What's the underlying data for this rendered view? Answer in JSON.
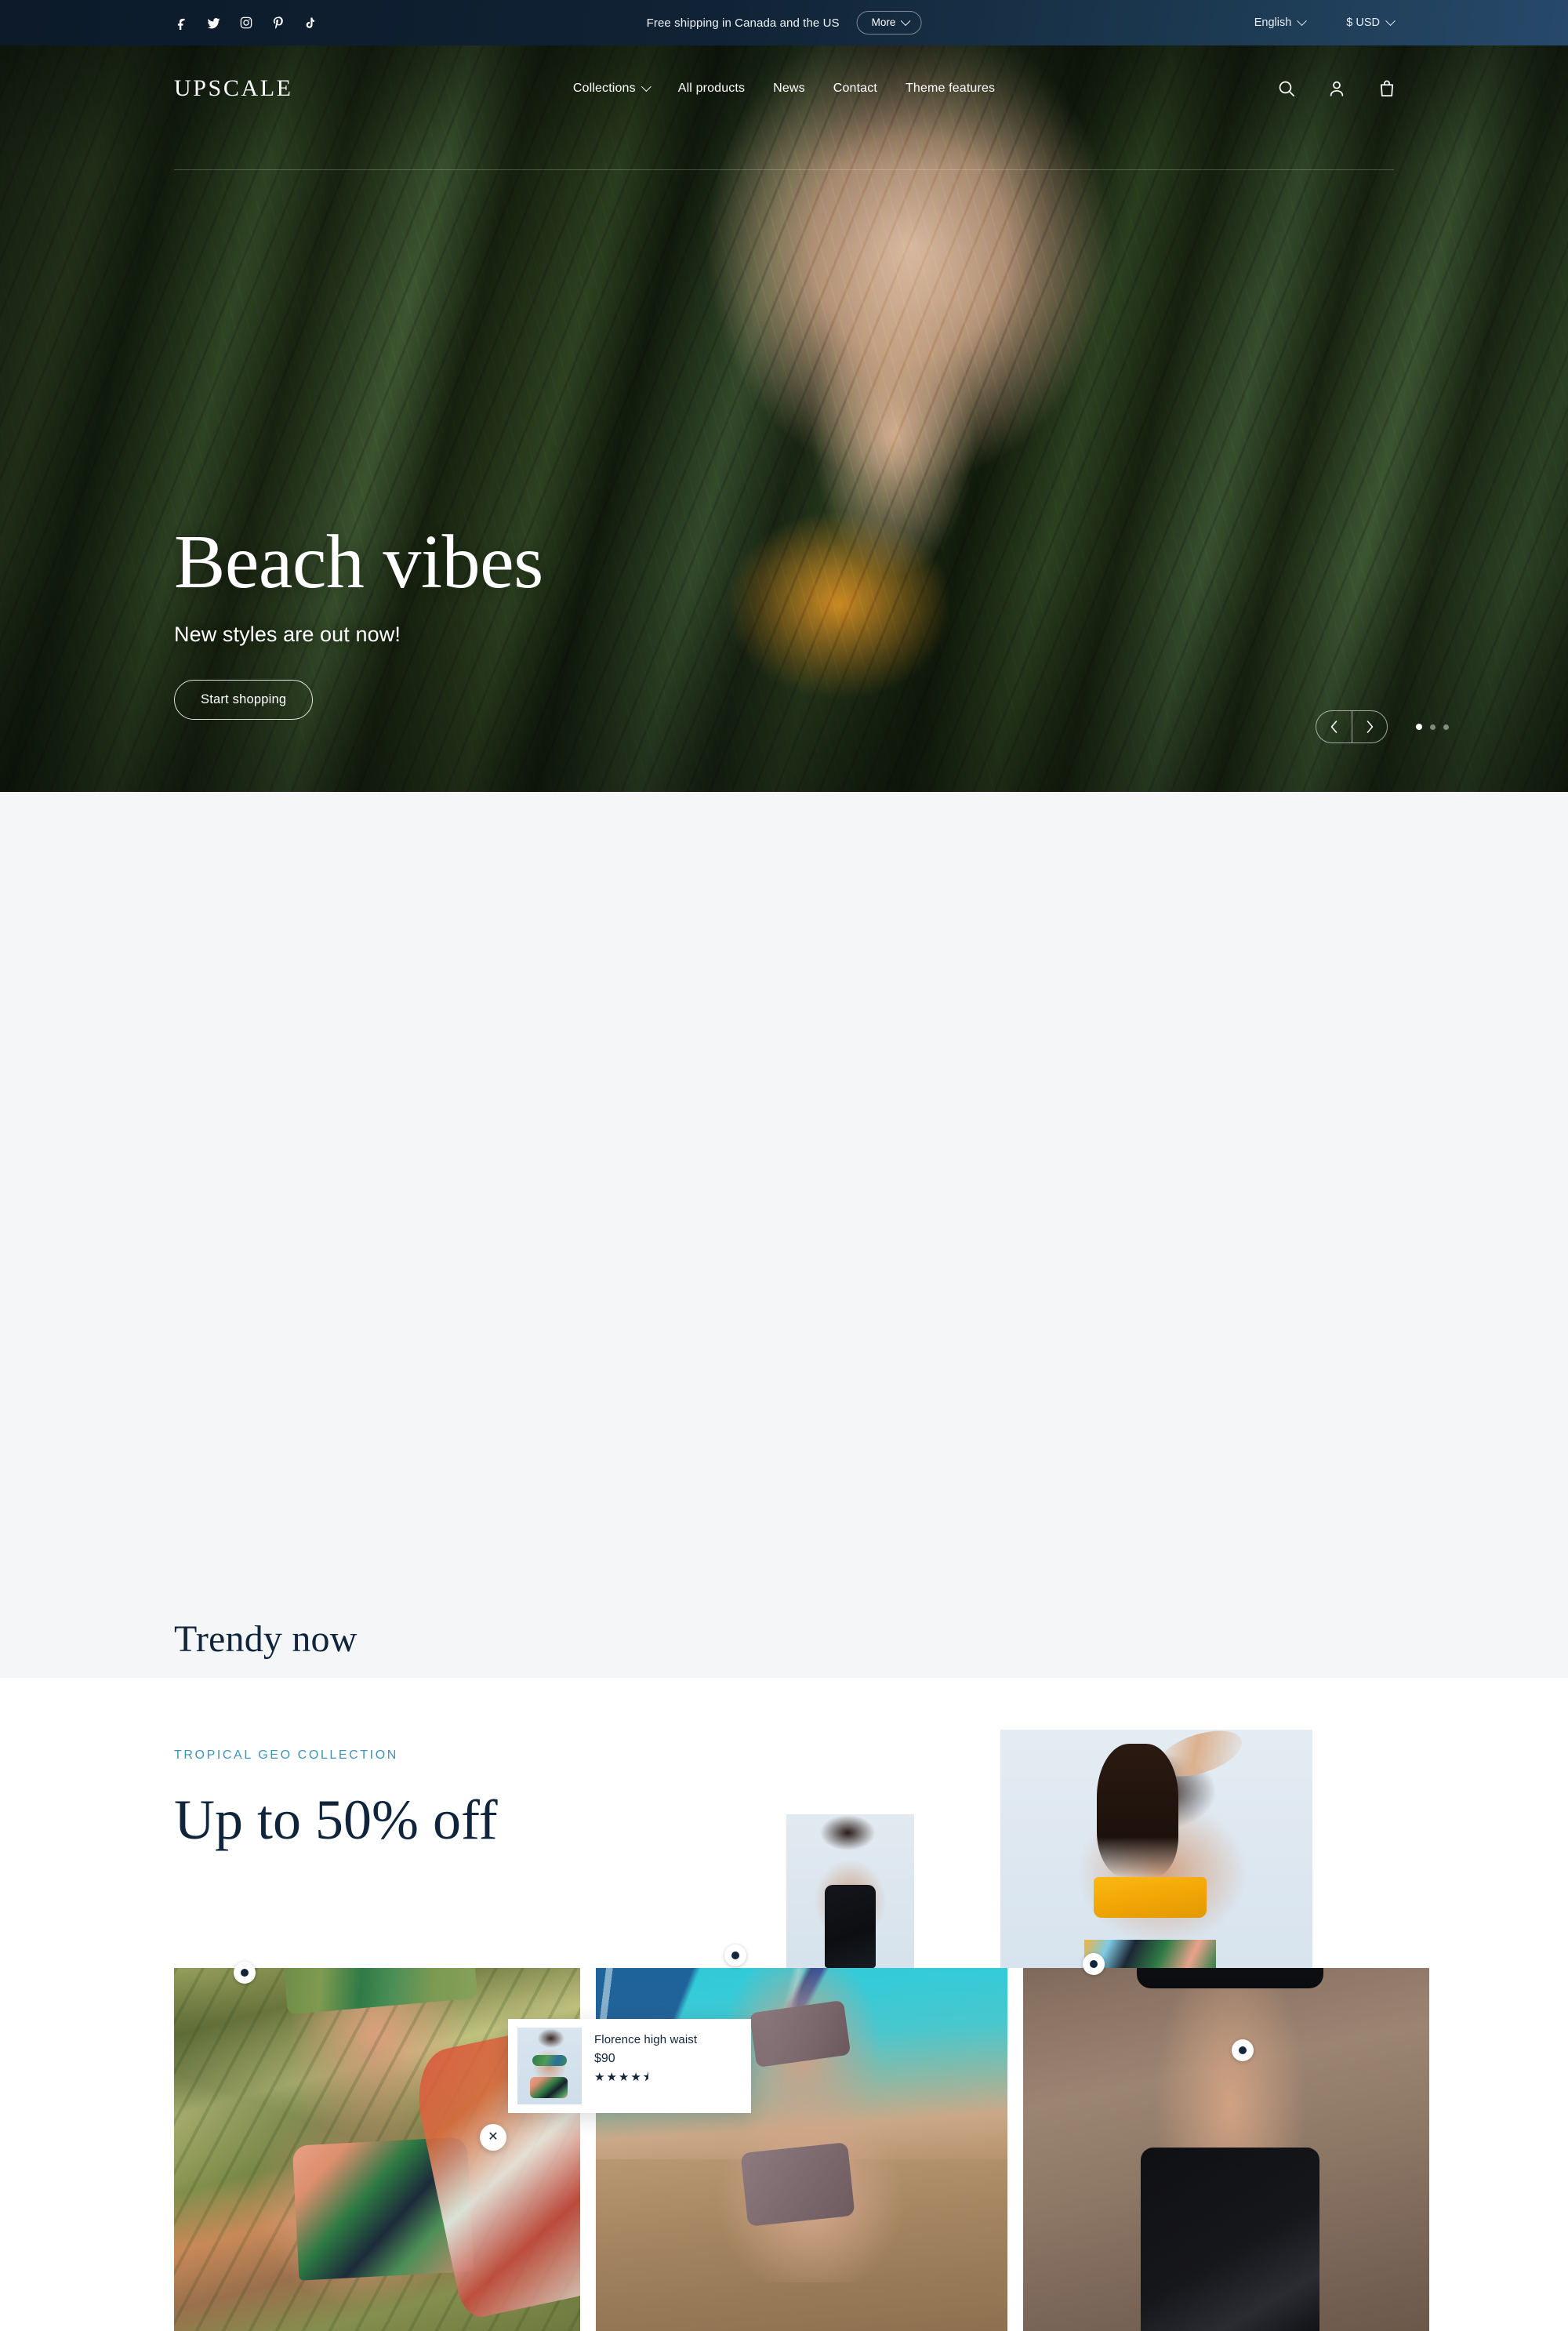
{
  "topbar": {
    "announcement": "Free shipping in Canada and the US",
    "more_label": "More",
    "language": "English",
    "currency": "$ USD",
    "social": [
      {
        "name": "facebook-icon",
        "label": "Facebook"
      },
      {
        "name": "twitter-icon",
        "label": "Twitter"
      },
      {
        "name": "instagram-icon",
        "label": "Instagram"
      },
      {
        "name": "pinterest-icon",
        "label": "Pinterest"
      },
      {
        "name": "tiktok-icon",
        "label": "TikTok"
      }
    ]
  },
  "header": {
    "logo": "UPSCALE",
    "nav": [
      {
        "label": "Collections",
        "has_dropdown": true
      },
      {
        "label": "All products",
        "has_dropdown": false
      },
      {
        "label": "News",
        "has_dropdown": false
      },
      {
        "label": "Contact",
        "has_dropdown": false
      },
      {
        "label": "Theme features",
        "has_dropdown": false
      }
    ],
    "icons": [
      "search-icon",
      "account-icon",
      "cart-icon"
    ]
  },
  "hero": {
    "title": "Beach vibes",
    "subtitle": "New styles are out now!",
    "cta": "Start shopping",
    "slide_count": 3,
    "active_slide": 1,
    "prev_label": "Previous slide",
    "next_label": "Next slide"
  },
  "trendy": {
    "heading": "Trendy now",
    "tiles": [
      {
        "alt": "Model in tropical print bikini among greenery",
        "hotspots": 1
      },
      {
        "alt": "Model by the pool in mauve swimsuit",
        "hotspots": 2
      },
      {
        "alt": "Model in black bandeau set wearing a straw hat",
        "hotspots": 2
      }
    ],
    "popup": {
      "product_name": "Florence high waist",
      "price": "$90",
      "stars": "★★★★",
      "half_star": "⯨",
      "rating": 4.5,
      "close_label": "✕"
    }
  },
  "promo": {
    "eyebrow": "Tropical geo collection",
    "title": "Up to 50% off",
    "accent_color": "#3e92bd"
  },
  "colors": {
    "navy": "#0d1b2a",
    "text_navy": "#10253c",
    "section_bg": "#f4f6f8",
    "accent_teal": "#3e92bd",
    "white": "#ffffff"
  }
}
